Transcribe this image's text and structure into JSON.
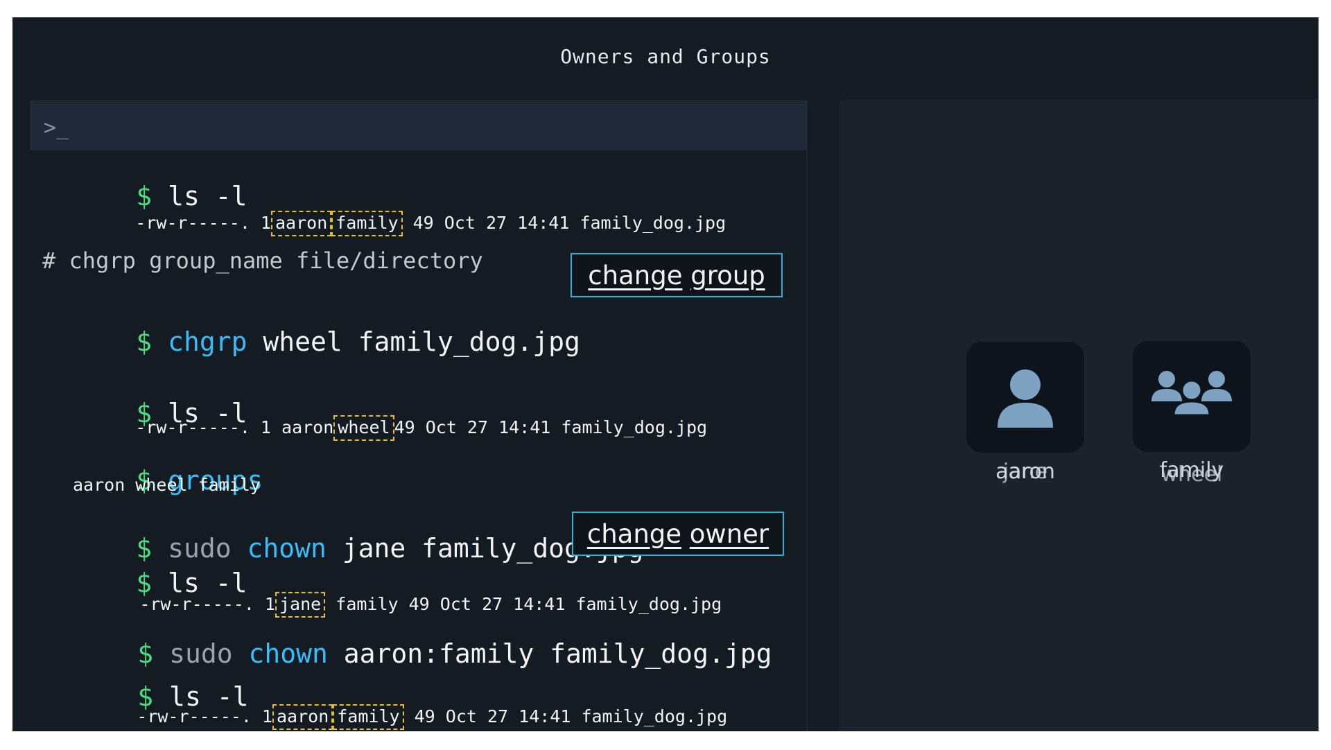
{
  "window": {
    "title": "Owners and Groups"
  },
  "terminal": {
    "prompt_icon": ">_",
    "lines": {
      "l1_cmd": "ls -l",
      "l1_out_perm": "-rw-r-----. 1",
      "l1_out_owner": "aaron",
      "l1_out_group": "family",
      "l1_out_rest": "49 Oct 27 14:41 family_dog.jpg",
      "comment": "# chgrp group_name file/directory",
      "l2_kw": "chgrp",
      "l2_args": "wheel family_dog.jpg",
      "l3_cmd": "ls -l",
      "l3_out_perm": "-rw-r-----. 1 aaron",
      "l3_out_group": "wheel",
      "l3_out_rest": "49 Oct 27 14:41 family_dog.jpg",
      "l4_kw": "groups",
      "l4_out": "aaron wheel family",
      "l5_sudo": "sudo",
      "l5_kw": "chown",
      "l5_args": "jane family_dog.jpg",
      "l6_cmd": "ls -l",
      "l6_out_perm": "-rw-r-----. 1",
      "l6_out_owner": "jane",
      "l6_out_rest": "family 49 Oct 27 14:41 family_dog.jpg",
      "l7_sudo": "sudo",
      "l7_kw": "chown",
      "l7_args": "aaron:family family_dog.jpg",
      "l8_cmd": "ls -l",
      "l8_out_perm": "-rw-r-----. 1",
      "l8_out_owner": "aaron",
      "l8_out_group": "family",
      "l8_out_rest": "49 Oct 27 14:41 family_dog.jpg"
    },
    "dollar": "$"
  },
  "buttons": {
    "change_group": {
      "w1": "change",
      "w2": "group"
    },
    "change_owner": {
      "w1": "change",
      "w2": "owner"
    }
  },
  "panel": {
    "user_tile": {
      "icon": "user-icon",
      "label_a": "aaron",
      "label_b": "jane"
    },
    "group_tile": {
      "icon": "group-icon",
      "label_a": "family",
      "label_b": "wheel"
    }
  },
  "colors": {
    "background": "#141b23",
    "prompt_green": "#4ade80",
    "keyword_blue": "#38bdf8",
    "highlight_yellow": "#e6c228",
    "button_border": "#2db3d6"
  }
}
